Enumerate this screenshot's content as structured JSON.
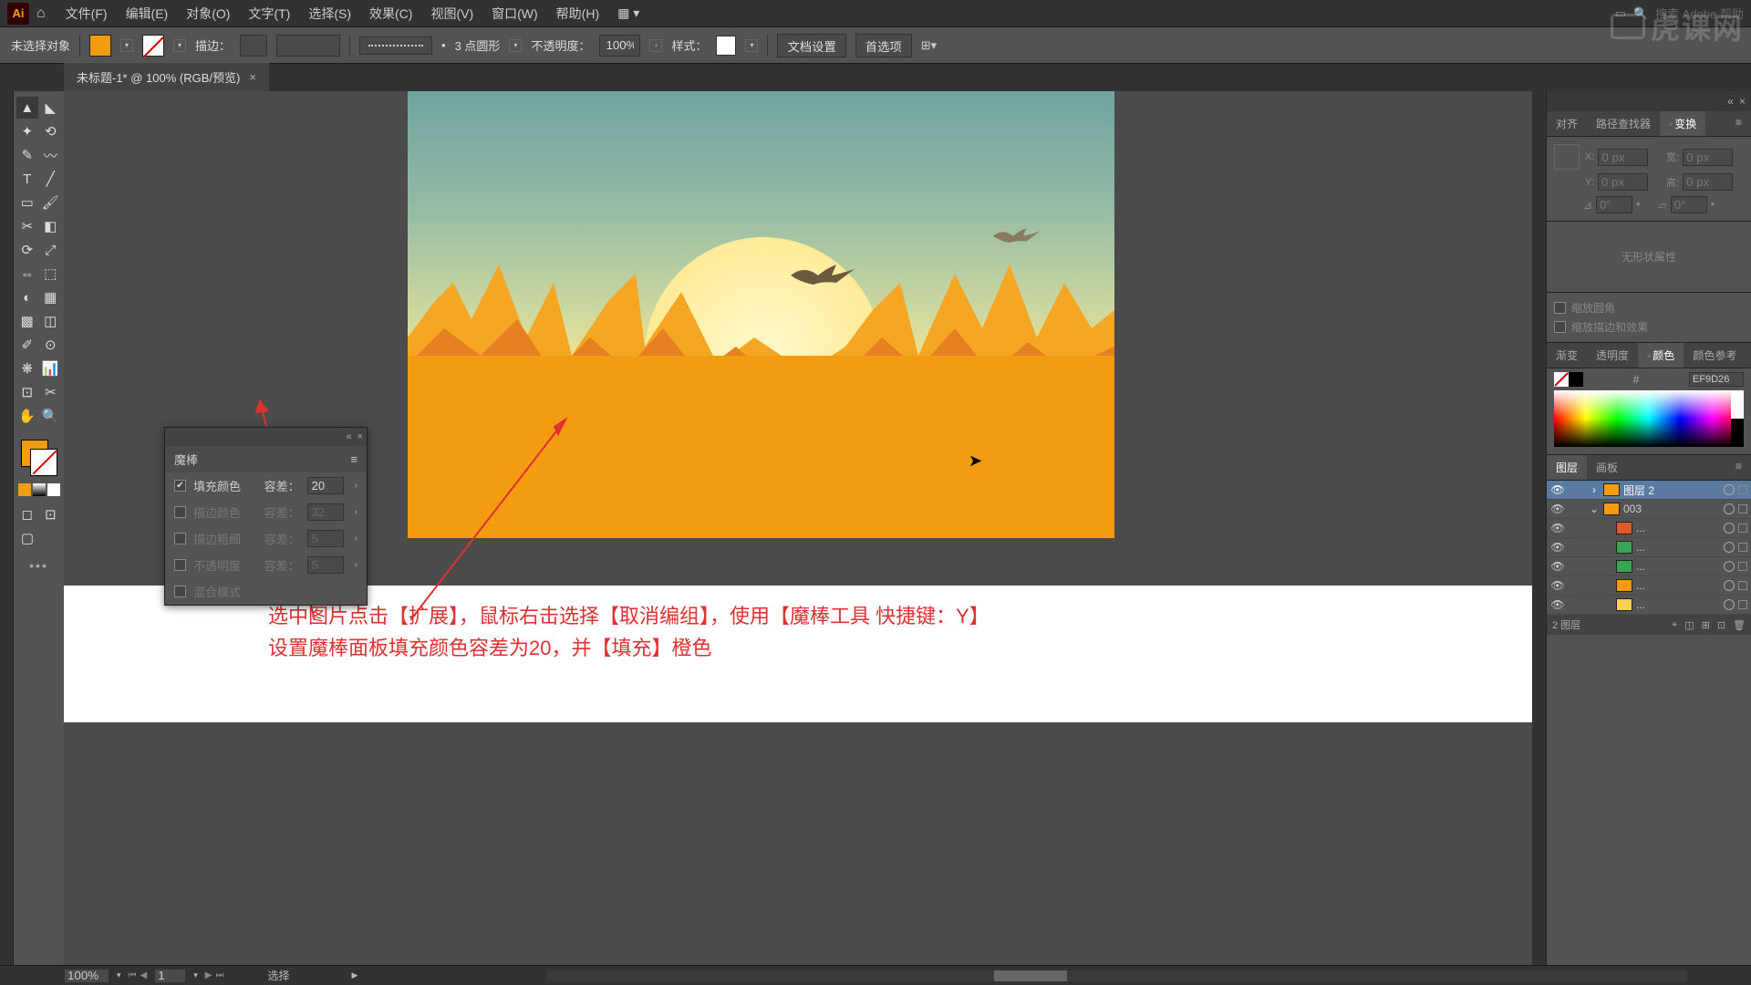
{
  "menubar": {
    "items": [
      "文件(F)",
      "编辑(E)",
      "对象(O)",
      "文字(T)",
      "选择(S)",
      "效果(C)",
      "视图(V)",
      "窗口(W)",
      "帮助(H)"
    ],
    "search_placeholder": "搜索 Adobe 帮助"
  },
  "controlbar": {
    "no_selection": "未选择对象",
    "stroke_label": "描边：",
    "stroke_profile": "3 点圆形",
    "opacity_label": "不透明度：",
    "opacity_value": "100%",
    "style_label": "样式：",
    "doc_setup": "文档设置",
    "prefs": "首选项"
  },
  "document": {
    "tab_title": "未标题-1* @ 100% (RGB/预览)"
  },
  "magicwand_panel": {
    "title": "魔棒",
    "fill_color": "填充颜色",
    "stroke_color": "描边颜色",
    "stroke_weight": "描边粗细",
    "opacity": "不透明度",
    "blend_mode": "混合模式",
    "tolerance_label": "容差：",
    "fill_tol": "20",
    "stroke_tol": "32",
    "weight_tol": "5",
    "opacity_tol": "5"
  },
  "annotation": {
    "line1": "选中图片点击【扩展】，鼠标右击选择【取消编组】，使用【魔棒工具 快捷键：Y】",
    "line2": "设置魔棒面板填充颜色容差为20，并【填充】橙色"
  },
  "right": {
    "align_tab": "对齐",
    "pathfinder_tab": "路径查找器",
    "transform_tab": "变换",
    "x_label": "X:",
    "x_val": "0 px",
    "y_label": "Y:",
    "y_val": "0 px",
    "w_label": "宽:",
    "w_val": "0 px",
    "h_label": "高:",
    "h_val": "0 px",
    "angle": "0°",
    "shear": "0°",
    "no_shape": "无形状属性",
    "scale_corners": "缩放圆角",
    "scale_stroke": "缩放描边和效果",
    "grad_tab": "渐变",
    "transp_tab": "透明度",
    "color_tab": "颜色",
    "guide_tab": "颜色参考",
    "hex_value": "EF9D26",
    "layers_tab": "图层",
    "artboards_tab": "画板",
    "layer_count": "2 图层",
    "layers": [
      {
        "name": "图层 2",
        "color": "#f39c12",
        "expand": "›",
        "sel": true,
        "indent": 0
      },
      {
        "name": "003",
        "color": "#f39c12",
        "expand": "⌄",
        "sel": false,
        "indent": 0
      },
      {
        "name": "...",
        "color": "#e05a2b",
        "expand": "",
        "sel": false,
        "indent": 1
      },
      {
        "name": "...",
        "color": "#3aa655",
        "expand": "",
        "sel": false,
        "indent": 1
      },
      {
        "name": "...",
        "color": "#3aa655",
        "expand": "",
        "sel": false,
        "indent": 1
      },
      {
        "name": "...",
        "color": "#f39c12",
        "expand": "",
        "sel": false,
        "indent": 1
      },
      {
        "name": "...",
        "color": "#f7d154",
        "expand": "",
        "sel": false,
        "indent": 1
      }
    ]
  },
  "statusbar": {
    "zoom": "100%",
    "artboard_num": "1",
    "tool_hint": "选择"
  },
  "watermark": "虎课网"
}
